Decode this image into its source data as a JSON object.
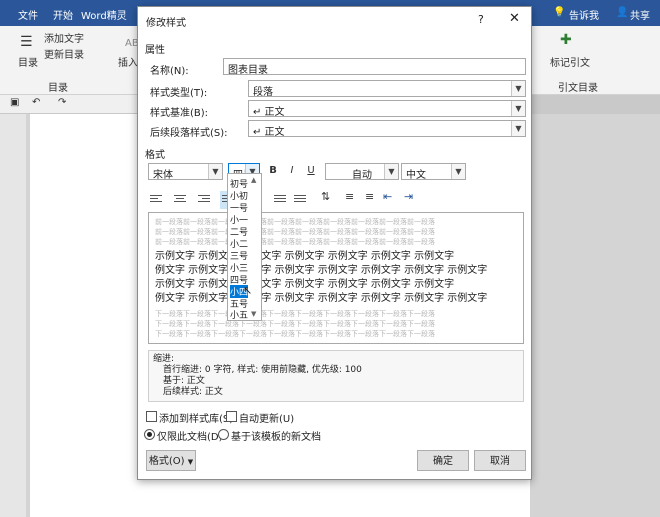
{
  "menubar": {
    "items": [
      "文件",
      "开始",
      "Word精灵",
      "",
      "告诉我",
      "共享"
    ],
    "share_label": "共享",
    "tell_label": "告诉我"
  },
  "ribbon": {
    "add_text": "添加文字",
    "update_toc": "更新目录",
    "toc_label": "目录",
    "toc_group": "目录",
    "insert_label": "插入",
    "ab_label": "AB",
    "mark_citation": "标记引文",
    "citation_group": "引文目录"
  },
  "dialog": {
    "title": "修改样式",
    "help": "?",
    "close": "✕",
    "properties_section": "属性",
    "name_label": "名称(N):",
    "name_value": "图表目录",
    "type_label": "样式类型(T):",
    "type_value": "段落",
    "based_label": "样式基准(B):",
    "based_value": "↵ 正文",
    "next_label": "后续段落样式(S):",
    "next_value": "↵ 正文",
    "format_section": "格式",
    "font_value": "宋体",
    "size_value": "四号",
    "bold": "B",
    "italic": "I",
    "underline": "U",
    "color_value": "自动",
    "lang_value": "中文",
    "preview_prev": "前一段落前一段落前一段落前一段落前一段落前一段落前一段落前一段落前一段落前一段落",
    "preview_sample": "示例文字",
    "preview_next": "下一段落下一段落下一段落下一段落下一段落下一段落下一段落下一段落下一段落下一段落",
    "desc_title": "缩进:",
    "desc_line1": "首行缩进:  0 字符, 样式: 使用前隐藏, 优先级: 100",
    "desc_line2": "基于: 正文",
    "desc_line3": "后续样式: 正文",
    "add_gallery": "添加到样式库(S)",
    "auto_update": "自动更新(U)",
    "only_doc": "仅限此文档(D)",
    "template_doc": "基于该模板的新文档",
    "format_btn": "格式(O)",
    "ok": "确定",
    "cancel": "取消"
  },
  "size_list": {
    "options": [
      "初号",
      "小初",
      "一号",
      "小一",
      "二号",
      "小二",
      "三号",
      "小三",
      "四号",
      "小四",
      "五号",
      "小五"
    ],
    "selected": "小四"
  }
}
